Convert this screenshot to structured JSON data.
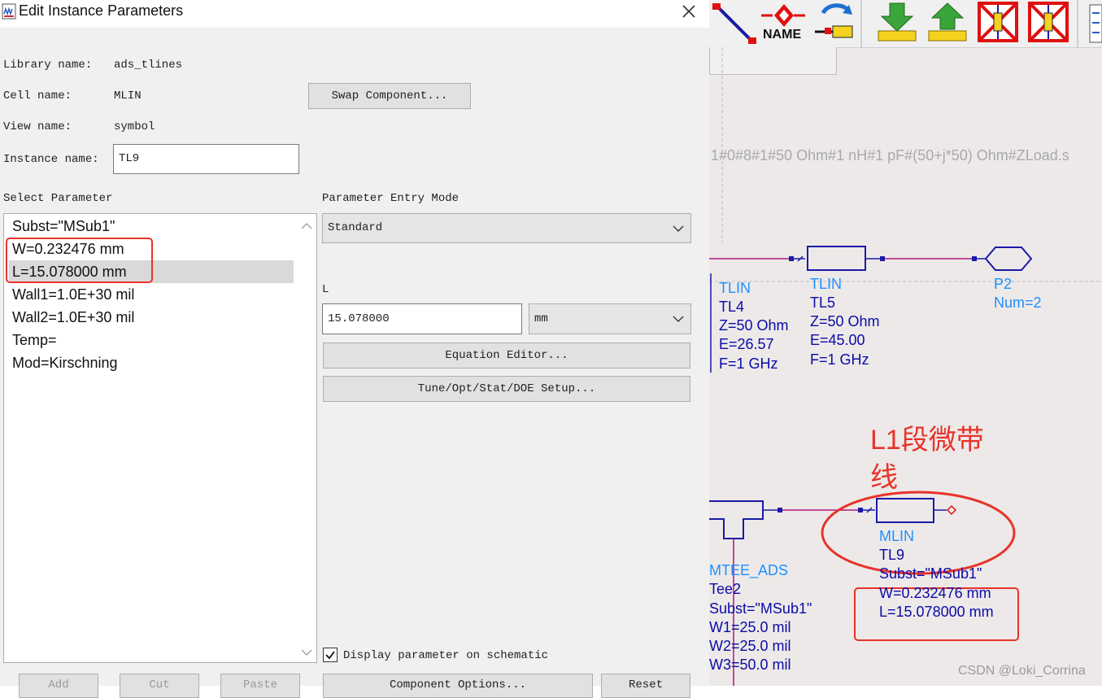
{
  "dialog": {
    "title": "Edit Instance Parameters",
    "library_label": "Library name:",
    "library_value": "ads_tlines",
    "cell_label": "Cell name:",
    "cell_value": "MLIN",
    "view_label": "View name:",
    "view_value": "symbol",
    "instance_label": "Instance name:",
    "instance_value": "TL9",
    "swap_button": "Swap Component...",
    "select_parameter_label": "Select Parameter",
    "parameters": [
      "Subst=\"MSub1\"",
      "W=0.232476 mm",
      "L=15.078000 mm",
      "Wall1=1.0E+30 mil",
      "Wall2=1.0E+30 mil",
      "Temp=",
      "Mod=Kirschning"
    ],
    "selected_parameter_index": 2,
    "entry_mode_label": "Parameter Entry Mode",
    "entry_mode_value": "Standard",
    "param_name": "L",
    "param_value": "15.078000",
    "unit_value": "mm",
    "equation_editor_button": "Equation Editor...",
    "tune_button": "Tune/Opt/Stat/DOE Setup...",
    "display_checkbox_label": "Display parameter on schematic",
    "display_checked": true,
    "bottom_buttons": [
      "Add",
      "Cut",
      "Paste"
    ],
    "component_options_button": "Component Options...",
    "reset_button": "Reset"
  },
  "toolbar": {
    "name_label": "NAME",
    "icons": [
      "wire-icon",
      "name-icon",
      "pin-icon",
      "push-down-icon",
      "pop-up-icon",
      "deactivate-icon",
      "short-icon"
    ]
  },
  "schematic": {
    "equation_text": "1#0#8#1#50 Ohm#1 nH#1 pF#(50+j*50) Ohm#ZLoad.s",
    "tl4": {
      "type": "TLIN",
      "name": "TL4",
      "z": "Z=50 Ohm",
      "e": "E=26.57",
      "f": "F=1 GHz"
    },
    "tl5": {
      "type": "TLIN",
      "name": "TL5",
      "z": "Z=50 Ohm",
      "e": "E=45.00",
      "f": "F=1 GHz"
    },
    "p2": {
      "name": "P2",
      "num": "Num=2"
    },
    "tee": {
      "type": "MTEE_ADS",
      "name": "Tee2",
      "subst": "Subst=\"MSub1\"",
      "w1": "W1=25.0 mil",
      "w2": "W2=25.0 mil",
      "w3": "W3=50.0 mil"
    },
    "tl9": {
      "type": "MLIN",
      "name": "TL9",
      "subst": "Subst=\"MSub1\"",
      "w": "W=0.232476 mm",
      "l": "L=15.078000 mm"
    },
    "annotation": "L1段微带线",
    "watermark": "CSDN @Loki_Corrina"
  },
  "colors": {
    "annotation_red": "#e8332a",
    "wire": "#b0187a",
    "component": "#1a1aa8",
    "type_label": "#1e90ff"
  }
}
